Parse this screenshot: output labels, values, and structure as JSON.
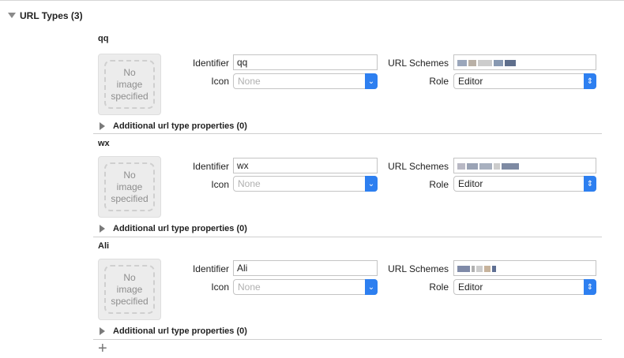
{
  "section": {
    "title": "URL Types (3)"
  },
  "labels": {
    "identifier": "Identifier",
    "icon": "Icon",
    "url_schemes": "URL Schemes",
    "role": "Role",
    "no_image": [
      "No",
      "image",
      "specified"
    ],
    "additional": "Additional url type properties (0)"
  },
  "url_types": [
    {
      "name": "qq",
      "identifier": "qq",
      "icon": "None",
      "role": "Editor"
    },
    {
      "name": "wx",
      "identifier": "wx",
      "icon": "None",
      "role": "Editor"
    },
    {
      "name": "Ali",
      "identifier": "Ali",
      "icon": "None",
      "role": "Editor"
    }
  ],
  "icons": {
    "section_disclosure": "disclosure-down-icon",
    "additional_disclosure": "disclosure-right-icon",
    "popup_chevron": "chevron-down-icon",
    "role_stepper": "up-down-chevron-icon",
    "add": "plus-icon"
  },
  "colors": {
    "accent": "#2d7ff0"
  }
}
